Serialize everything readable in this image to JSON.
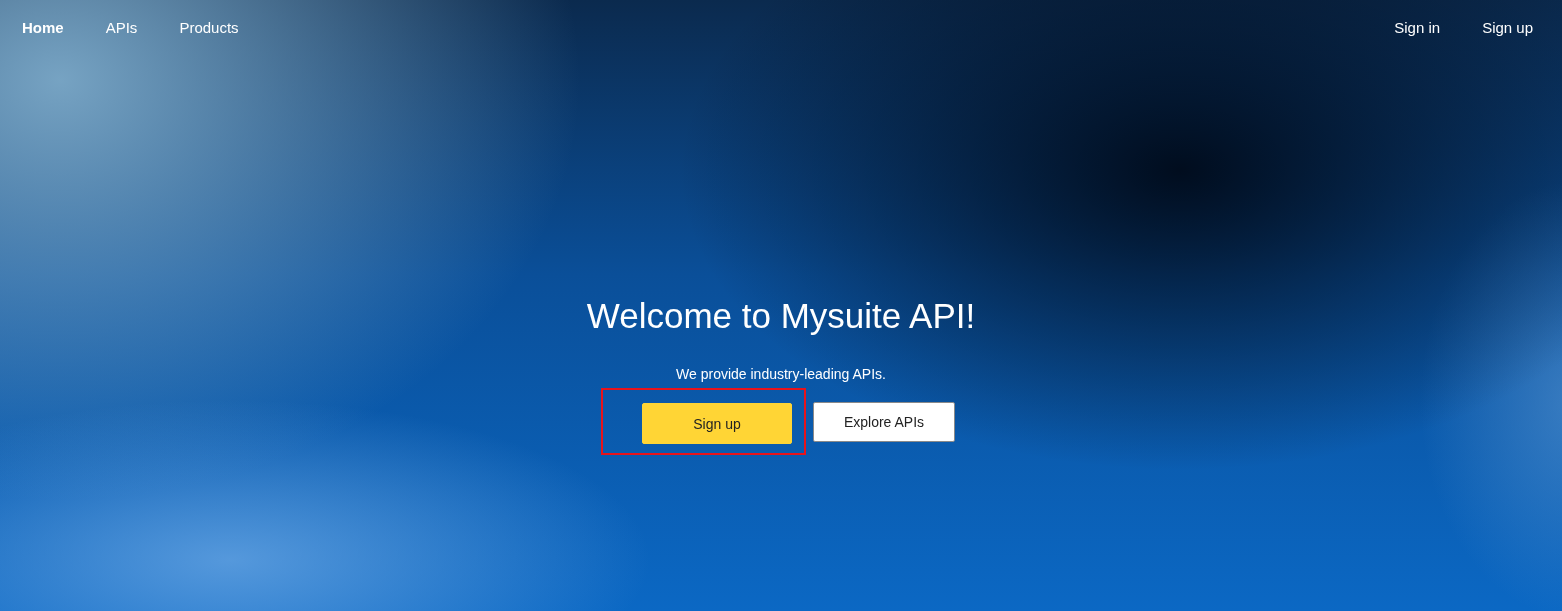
{
  "nav": {
    "left": [
      {
        "label": "Home",
        "selected": true
      },
      {
        "label": "APIs",
        "selected": false
      },
      {
        "label": "Products",
        "selected": false
      }
    ],
    "right": [
      {
        "label": "Sign in"
      },
      {
        "label": "Sign up"
      }
    ]
  },
  "hero": {
    "title": "Welcome to Mysuite API!",
    "subtitle": "We provide industry-leading APIs.",
    "buttons": [
      {
        "label": "Sign up",
        "kind": "primary",
        "highlighted": true
      },
      {
        "label": "Explore APIs",
        "kind": "secondary",
        "highlighted": false
      }
    ]
  }
}
